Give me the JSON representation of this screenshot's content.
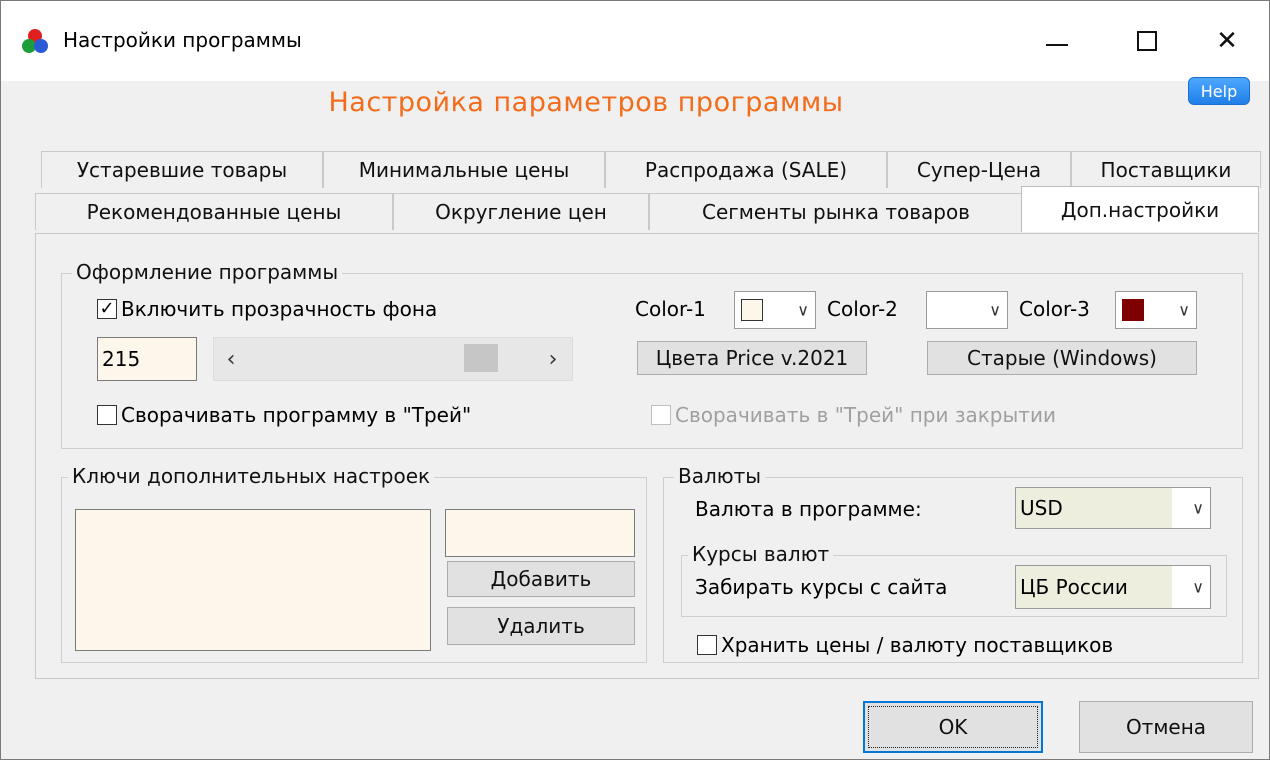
{
  "window": {
    "title": "Настройки программы",
    "controls": {
      "minimize": "—",
      "maximize": "☐",
      "close": "✕"
    }
  },
  "help_label": "Help",
  "heading": "Настройка параметров программы",
  "tabs": {
    "row1": [
      "Устаревшие товары",
      "Минимальные цены",
      "Распродажа (SALE)",
      "Супер-Цена",
      "Поставщики"
    ],
    "row2": [
      "Рекомендованные цены",
      "Округление цен",
      "Сегменты рынка товаров",
      "Доп.настройки"
    ],
    "active": "Доп.настройки"
  },
  "appearance": {
    "group_label": "Оформление программы",
    "transparency_label": "Включить прозрачность фона",
    "transparency_checked": true,
    "transparency_value": "215",
    "scroll_left": "‹",
    "scroll_right": "›",
    "tray_label": "Сворачивать программу в \"Трей\"",
    "tray_checked": false,
    "tray_close_label": "Сворачивать в \"Трей\" при закрытии",
    "tray_close_checked": false,
    "color1_label": "Color-1",
    "color2_label": "Color-2",
    "color3_label": "Color-3",
    "color1": "#fdf6ea",
    "color3": "#7f0000",
    "preset1_label": "Цвета Price v.2021",
    "preset2_label": "Старые (Windows)"
  },
  "keys": {
    "group_label": "Ключи дополнительных настроек",
    "key_input": "",
    "add_label": "Добавить",
    "delete_label": "Удалить"
  },
  "currency": {
    "group_label": "Валюты",
    "currency_label": "Валюта в программе:",
    "currency_value": "USD",
    "rates_group_label": "Курсы валют",
    "rates_label": "Забирать курсы с сайта",
    "rates_value": "ЦБ России",
    "store_label": "Хранить цены / валюту поставщиков",
    "store_checked": false
  },
  "footer": {
    "ok_label": "OK",
    "cancel_label": "Отмена"
  }
}
